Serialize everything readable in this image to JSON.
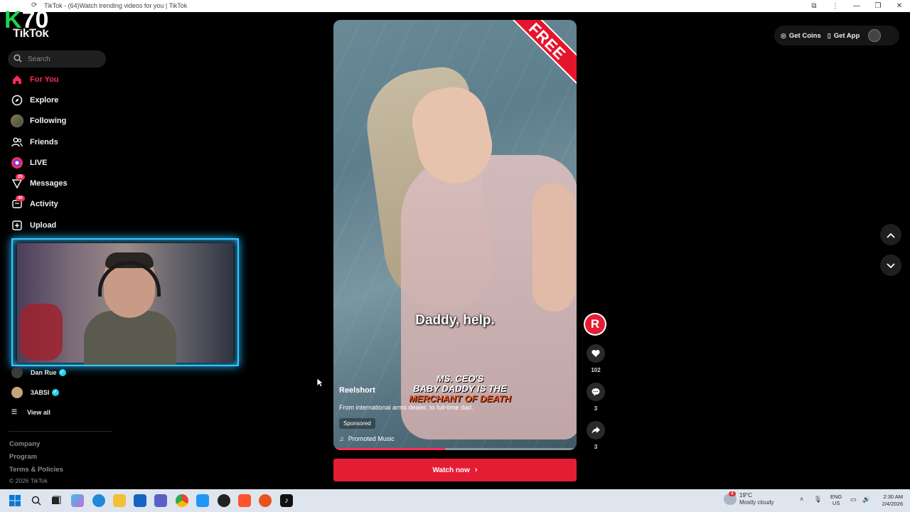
{
  "window": {
    "title": "TikTok - (64)Watch trending videos for you | TikTok",
    "controls": [
      "minimize",
      "restore",
      "close"
    ]
  },
  "overlay": {
    "k70_logo": "70",
    "k_letter": "K"
  },
  "brand": {
    "logo_text": "TikTok"
  },
  "search": {
    "placeholder": "Search"
  },
  "nav": {
    "items": [
      {
        "label": "For You",
        "icon": "home-icon",
        "active": true
      },
      {
        "label": "Explore",
        "icon": "compass-icon"
      },
      {
        "label": "Following",
        "icon": "following-avatar"
      },
      {
        "label": "Friends",
        "icon": "friends-icon"
      },
      {
        "label": "LIVE",
        "icon": "live-icon"
      },
      {
        "label": "Messages",
        "icon": "messages-icon",
        "badge": "25"
      },
      {
        "label": "Activity",
        "icon": "activity-icon",
        "badge": "40"
      },
      {
        "label": "Upload",
        "icon": "upload-icon"
      }
    ]
  },
  "following_accounts": [
    {
      "name": "Dan Rue",
      "verified": true
    },
    {
      "name": "3ABSI",
      "verified": true
    }
  ],
  "view_all": "View all",
  "footer": {
    "links": [
      "Company",
      "Program",
      "Terms & Policies"
    ],
    "copyright": "© 2026 TikTok"
  },
  "video": {
    "ribbon": "FREE",
    "subtitle": "Daddy, help.",
    "show_title": [
      "MS. CEO'S",
      "BABY DADDY IS THE",
      "MERCHANT OF DEATH"
    ],
    "author": "Reelshort",
    "description": "From international arms dealer, to full-time dad.",
    "sponsored": "Sponsored",
    "music": "Promoted Music",
    "progress": 0.46
  },
  "cta": {
    "label": "Watch now"
  },
  "actions": {
    "avatar_letter": "R",
    "likes": "102",
    "comments": "3",
    "shares": "3"
  },
  "header": {
    "get_coins": "Get Coins",
    "get_app": "Get App"
  },
  "taskbar": {
    "weather_badge": "4",
    "temperature": "19°C",
    "weather_desc": "Mostly cloudy",
    "lang_line1": "ENG",
    "lang_line2": "US",
    "time": "2:30 AM",
    "date": "2/4/2026"
  },
  "colors": {
    "accent": "#fe2c55",
    "cta": "#e41d35",
    "webcam_border": "#33c8ff"
  }
}
